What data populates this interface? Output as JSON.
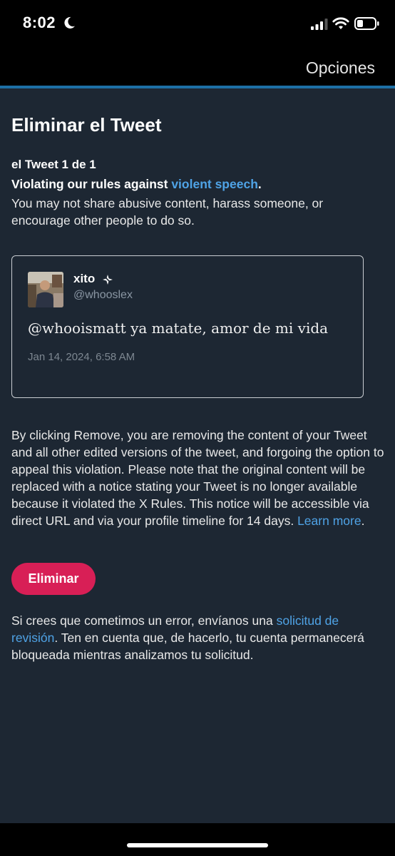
{
  "status_bar": {
    "time": "8:02",
    "icons": [
      "moon-icon",
      "signal-icon",
      "wifi-icon",
      "battery-icon"
    ]
  },
  "nav": {
    "options_label": "Opciones",
    "accent_color": "#1d6fa5"
  },
  "page": {
    "title": "Eliminar el Tweet",
    "counter": "el Tweet 1 de 1",
    "violation_prefix": "Violating our rules against ",
    "violation_link": "violent speech",
    "violation_suffix": ".",
    "policy_text": "You may not share abusive content, harass someone, or encourage other people to do so."
  },
  "tweet": {
    "name": "xito",
    "handle": "@whooslex",
    "text": "@whooismatt ya matate, amor de mi vida",
    "date": "Jan 14, 2024, 6:58 AM"
  },
  "remove_notice": {
    "text": "By clicking Remove, you are removing the content of your Tweet and all other edited versions of the tweet, and forgoing the option to appeal this violation. Please note that the original content will be replaced with a notice stating your Tweet is no longer available because it violated the X Rules. This notice will be accessible via direct URL and via your profile timeline for 14 days. ",
    "link": "Learn more",
    "suffix": "."
  },
  "remove_button": {
    "label": "Eliminar",
    "color": "#d81f56"
  },
  "appeal": {
    "prefix": "Si crees que cometimos un error, envíanos una ",
    "link": "solicitud de revisión",
    "suffix": ". Ten en cuenta que, de hacerlo, tu cuenta permanecerá bloqueada mientras analizamos tu solicitud."
  },
  "colors": {
    "background": "#1d2733",
    "link": "#4fa3e6"
  }
}
